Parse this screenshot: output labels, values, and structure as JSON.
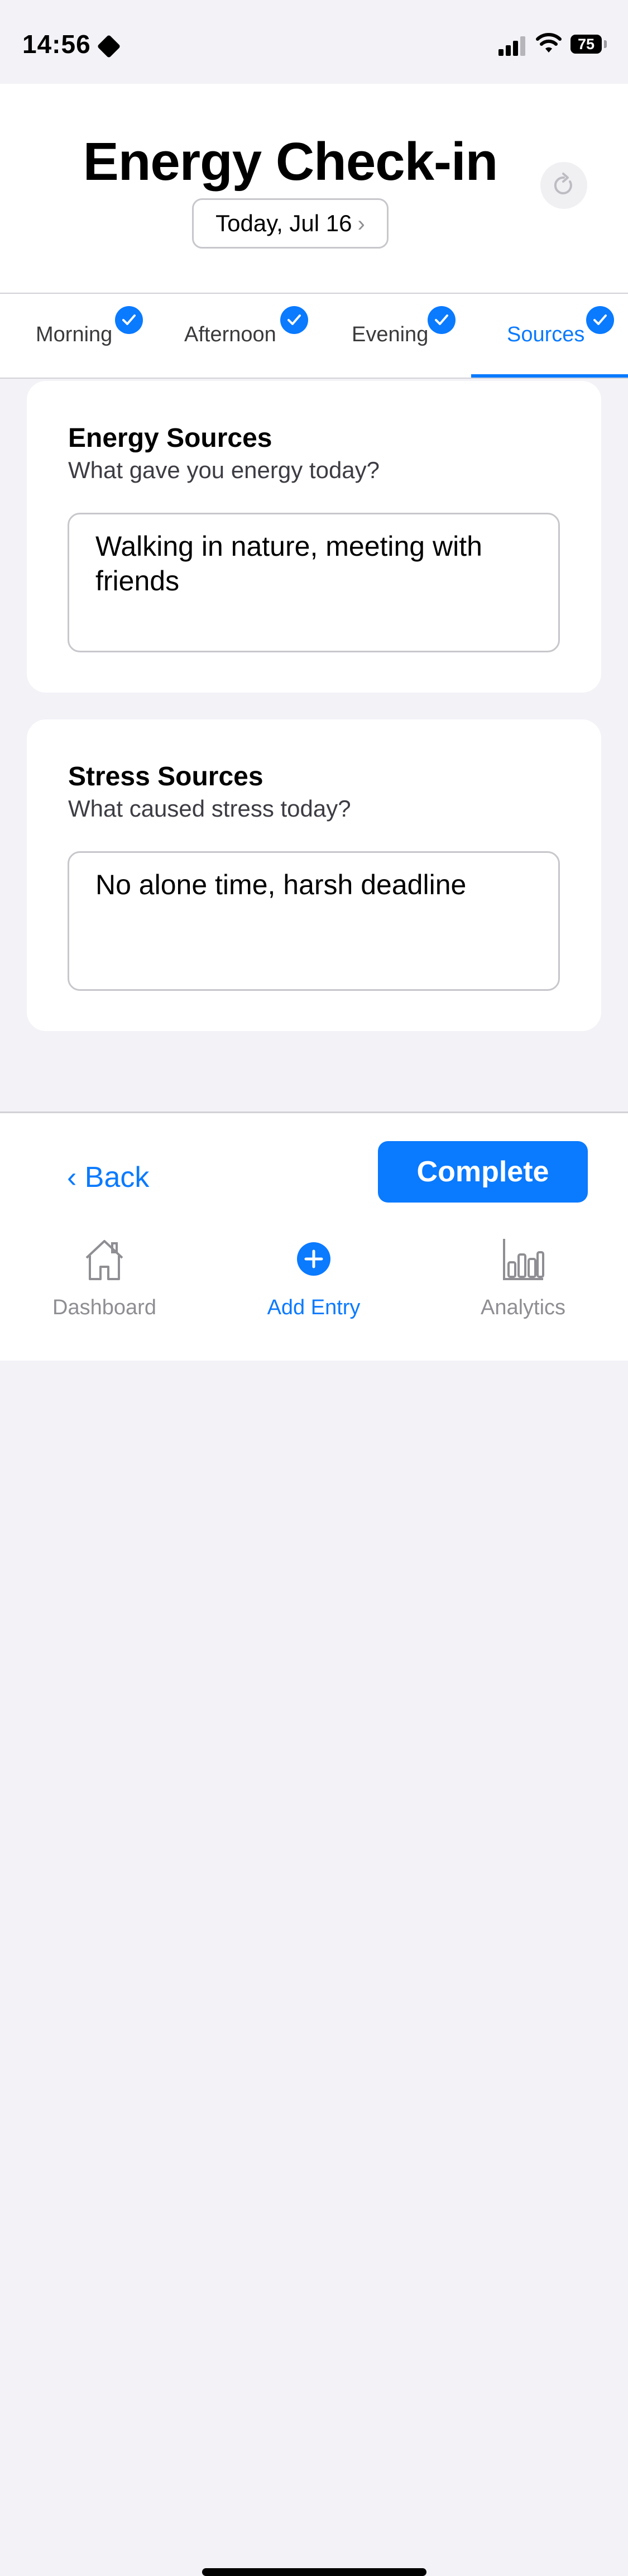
{
  "status_bar": {
    "time": "14:56",
    "battery": "75"
  },
  "header": {
    "title": "Energy Check-in",
    "date": "Today, Jul 16",
    "date_chevron": "›"
  },
  "tabs": [
    {
      "label": "Morning",
      "completed": true,
      "active": false
    },
    {
      "label": "Afternoon",
      "completed": true,
      "active": false
    },
    {
      "label": "Evening",
      "completed": true,
      "active": false
    },
    {
      "label": "Sources",
      "completed": true,
      "active": true
    }
  ],
  "cards": {
    "energy": {
      "title": "Energy Sources",
      "subtitle": "What gave you energy today?",
      "value": "Walking in nature, meeting with friends"
    },
    "stress": {
      "title": "Stress Sources",
      "subtitle": "What caused stress today?",
      "value": "No alone time, harsh deadline"
    }
  },
  "actions": {
    "back_label": "‹ Back",
    "complete_label": "Complete"
  },
  "tab_bar": {
    "items": [
      {
        "label": "Dashboard",
        "icon": "house-icon",
        "active": false
      },
      {
        "label": "Add Entry",
        "icon": "plus-circle-icon",
        "active": true
      },
      {
        "label": "Analytics",
        "icon": "bar-chart-icon",
        "active": false
      }
    ]
  },
  "colors": {
    "accent": "#0a7aff",
    "background": "#f2f2f7",
    "inactive": "#8e8e93"
  }
}
